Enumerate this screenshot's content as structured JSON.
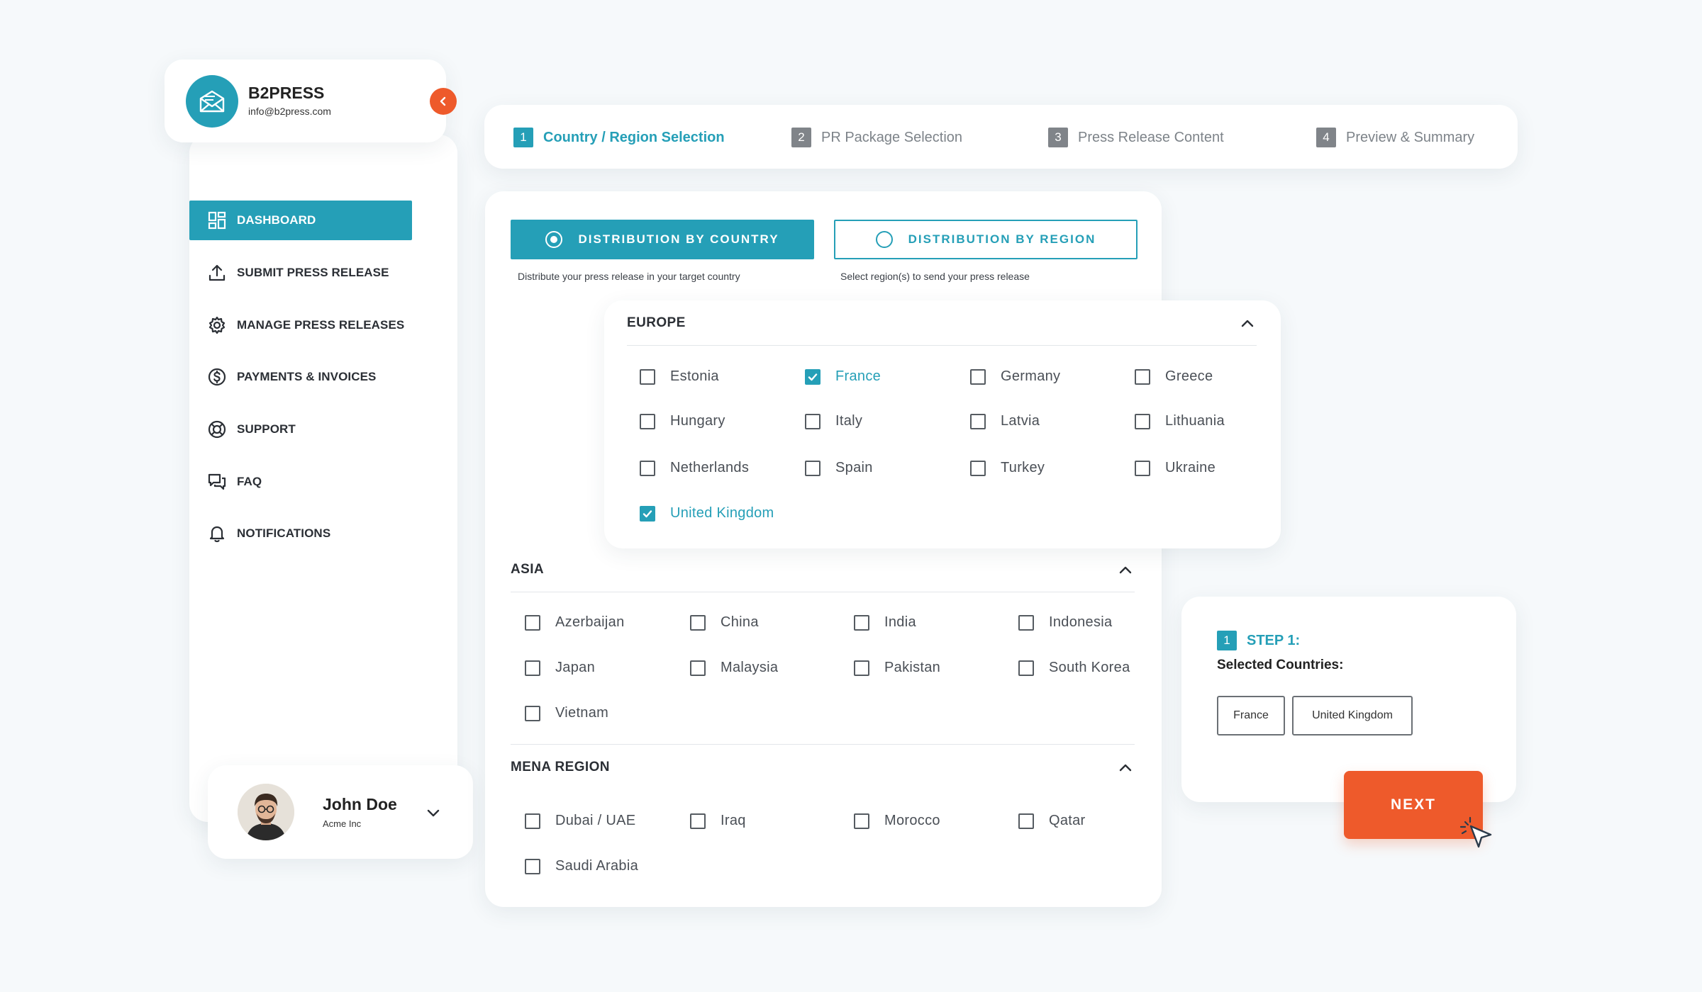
{
  "brand": {
    "name": "B2PRESS",
    "email": "info@b2press.com"
  },
  "nav": [
    {
      "label": "DASHBOARD",
      "icon": "dashboard-icon",
      "active": true
    },
    {
      "label": "SUBMIT PRESS RELEASE",
      "icon": "upload-icon"
    },
    {
      "label": "MANAGE PRESS RELEASES",
      "icon": "gear-icon"
    },
    {
      "label": "PAYMENTS & INVOICES",
      "icon": "dollar-icon"
    },
    {
      "label": "SUPPORT",
      "icon": "lifebuoy-icon"
    },
    {
      "label": "FAQ",
      "icon": "chat-icon"
    },
    {
      "label": "NOTIFICATIONS",
      "icon": "bell-icon"
    }
  ],
  "user": {
    "name": "John Doe",
    "company": "Acme Inc"
  },
  "steps": [
    {
      "num": "1",
      "label": "Country / Region Selection",
      "active": true
    },
    {
      "num": "2",
      "label": "PR Package Selection"
    },
    {
      "num": "3",
      "label": "Press Release Content"
    },
    {
      "num": "4",
      "label": "Preview & Summary"
    }
  ],
  "distribution": {
    "country": {
      "label": "DISTRIBUTION BY COUNTRY",
      "desc": "Distribute your press release in your target country",
      "selected": true
    },
    "region": {
      "label": "DISTRIBUTION BY REGION",
      "desc": "Select region(s) to send your press release",
      "selected": false
    }
  },
  "regions": {
    "europe": {
      "title": "EUROPE",
      "countries": [
        {
          "name": "Estonia",
          "checked": false
        },
        {
          "name": "France",
          "checked": true
        },
        {
          "name": "Germany",
          "checked": false
        },
        {
          "name": "Greece",
          "checked": false
        },
        {
          "name": "Hungary",
          "checked": false
        },
        {
          "name": "Italy",
          "checked": false
        },
        {
          "name": "Latvia",
          "checked": false
        },
        {
          "name": "Lithuania",
          "checked": false
        },
        {
          "name": "Netherlands",
          "checked": false
        },
        {
          "name": "Spain",
          "checked": false
        },
        {
          "name": "Turkey",
          "checked": false
        },
        {
          "name": "Ukraine",
          "checked": false
        },
        {
          "name": "United Kingdom",
          "checked": true
        }
      ]
    },
    "asia": {
      "title": "ASIA",
      "countries": [
        {
          "name": "Azerbaijan",
          "checked": false
        },
        {
          "name": "China",
          "checked": false
        },
        {
          "name": "India",
          "checked": false
        },
        {
          "name": "Indonesia",
          "checked": false
        },
        {
          "name": "Japan",
          "checked": false
        },
        {
          "name": "Malaysia",
          "checked": false
        },
        {
          "name": "Pakistan",
          "checked": false
        },
        {
          "name": "South Korea",
          "checked": false
        },
        {
          "name": "Vietnam",
          "checked": false
        }
      ]
    },
    "mena": {
      "title": "MENA REGION",
      "countries": [
        {
          "name": "Dubai / UAE",
          "checked": false
        },
        {
          "name": "Iraq",
          "checked": false
        },
        {
          "name": "Morocco",
          "checked": false
        },
        {
          "name": "Qatar",
          "checked": false
        },
        {
          "name": "Saudi Arabia",
          "checked": false
        }
      ]
    }
  },
  "summary": {
    "step_num": "1",
    "step_label": "STEP 1:",
    "label": "Selected Countries:",
    "chips": [
      "France",
      "United Kingdom"
    ]
  },
  "next_label": "NEXT",
  "colors": {
    "accent": "#259fb7",
    "orange": "#ee5a2b",
    "background": "#f6f9fb"
  }
}
